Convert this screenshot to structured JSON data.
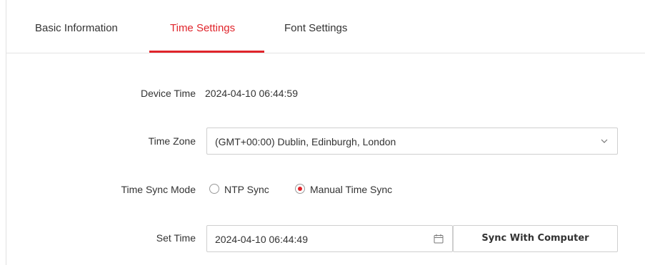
{
  "tabs": [
    {
      "label": "Basic Information",
      "active": false
    },
    {
      "label": "Time Settings",
      "active": true
    },
    {
      "label": "Font Settings",
      "active": false
    }
  ],
  "accent_color": "#e0242b",
  "device_time": {
    "label": "Device Time",
    "value": "2024-04-10 06:44:59"
  },
  "time_zone": {
    "label": "Time Zone",
    "selected": "(GMT+00:00) Dublin, Edinburgh, London",
    "icon": "chevron-down-icon"
  },
  "time_sync_mode": {
    "label": "Time Sync Mode",
    "options": [
      {
        "label": "NTP Sync",
        "checked": false
      },
      {
        "label": "Manual Time Sync",
        "checked": true
      }
    ]
  },
  "set_time": {
    "label": "Set Time",
    "value": "2024-04-10 06:44:49",
    "icon": "calendar-icon",
    "sync_button_label": "Sync With Computer"
  }
}
